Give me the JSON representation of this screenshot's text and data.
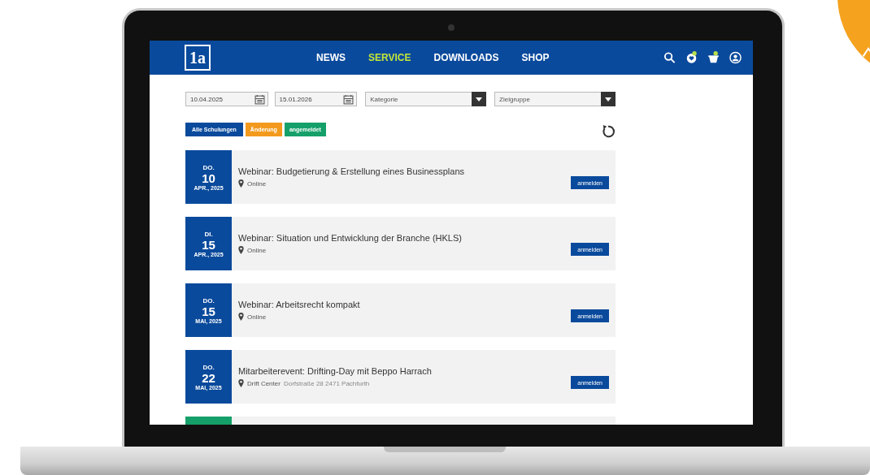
{
  "nav": {
    "logo": "1a",
    "items": [
      {
        "label": "NEWS",
        "selected": false
      },
      {
        "label": "SERVICE",
        "selected": true
      },
      {
        "label": "DOWNLOADS",
        "selected": false
      },
      {
        "label": "SHOP",
        "selected": false
      }
    ]
  },
  "filters": {
    "date_from": "10.04.2025",
    "date_to": "15.01.2026",
    "category": {
      "placeholder": "Kategorie"
    },
    "audience": {
      "placeholder": "Zielgruppe"
    }
  },
  "chips": [
    {
      "label": "Alle Schulungen",
      "color": "#0a4a9c"
    },
    {
      "label": "Änderung",
      "color": "#f39a1e"
    },
    {
      "label": "angemeldet",
      "color": "#15a06a"
    }
  ],
  "events": [
    {
      "weekday": "DO.",
      "day": "10",
      "month_year": "APR., 2025",
      "title": "Webinar: Budgetierung & Erstellung eines Businessplans",
      "venue": "Online",
      "button": "anmelden",
      "color": "#0a4a9c"
    },
    {
      "weekday": "DI.",
      "day": "15",
      "month_year": "APR., 2025",
      "title": "Webinar: Situation und Entwicklung der Branche (HKLS)",
      "venue": "Online",
      "button": "anmelden",
      "color": "#0a4a9c"
    },
    {
      "weekday": "DO.",
      "day": "15",
      "month_year": "MAI, 2025",
      "title": "Webinar: Arbeitsrecht kompakt",
      "venue": "Online",
      "button": "anmelden",
      "color": "#0a4a9c"
    },
    {
      "weekday": "DO.",
      "day": "22",
      "month_year": "MAI, 2025",
      "title": "Mitarbeiterevent: Drifting-Day mit Beppo Harrach",
      "venue": "Drift Center",
      "address": "Dorfstraße 28 2471 Pachfurth",
      "button": "anmelden",
      "color": "#0a4a9c"
    },
    {
      "color": "#15a06a"
    }
  ]
}
